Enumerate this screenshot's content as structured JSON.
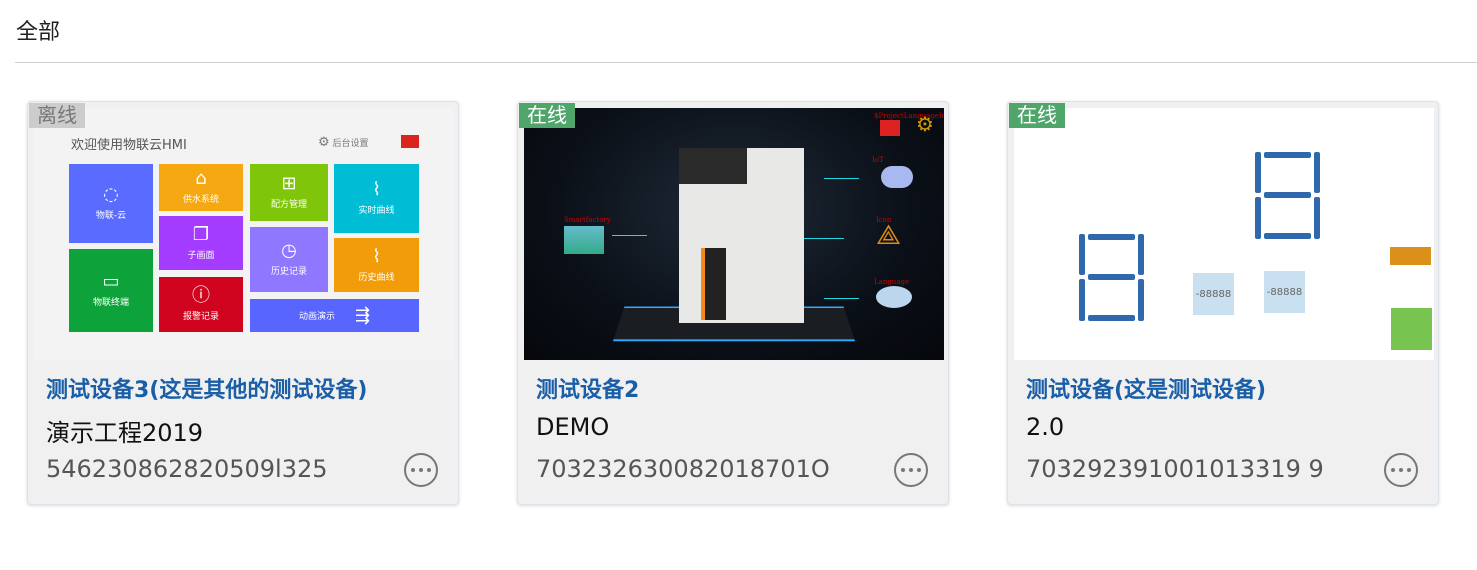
{
  "header": {
    "title": "全部"
  },
  "devices": [
    {
      "status": "离线",
      "online": false,
      "name": "测试设备3(这是其他的测试设备)",
      "project": "演示工程2019",
      "serial": "546230862820509l325",
      "thumb": {
        "welcome": "欢迎使用物联云HMI",
        "settings": "后台设置",
        "tiles": [
          "物联-云",
          "物联终端",
          "供水系统",
          "子画面",
          "报警记录",
          "配方管理",
          "历史记录",
          "实时曲线",
          "历史曲线",
          "动画演示"
        ],
        "tile_colors": [
          "#5a6cff",
          "#0ea33a",
          "#f6a812",
          "#a33cff",
          "#d0041e",
          "#7fc50a",
          "#8f78ff",
          "#00bcd4",
          "#f29c0a",
          "#5865ff"
        ]
      }
    },
    {
      "status": "在线",
      "online": true,
      "name": "测试设备2",
      "project": "DEMO",
      "serial": "703232630082018701O",
      "thumb": {
        "labels": [
          "Smartfactory",
          "IoT",
          "Icon",
          "Language",
          "$ProjectLanguageIc"
        ]
      }
    },
    {
      "status": "在线",
      "online": true,
      "name": "测试设备(这是测试设备)",
      "project": "2.0",
      "serial": "703292391001013319 9",
      "thumb": {
        "readouts": [
          "-88888",
          "-88888"
        ]
      }
    }
  ]
}
